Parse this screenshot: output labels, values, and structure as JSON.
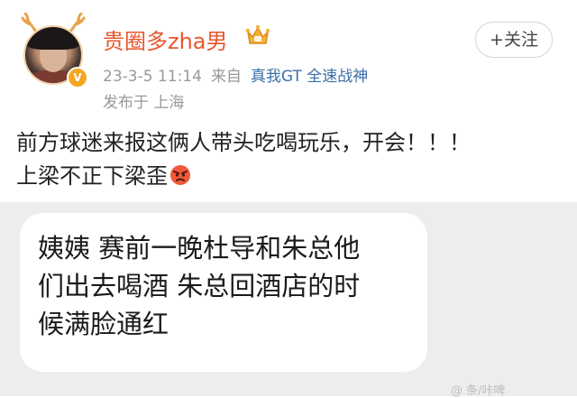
{
  "user": {
    "name": "贵圈多zha男",
    "verified_badge": "V",
    "follow_label": "+关注"
  },
  "meta": {
    "date": "23-3-5 11:14",
    "source_prefix": "来自",
    "device": "真我GT 全速战神",
    "location": "发布于 上海"
  },
  "post": {
    "line1": "前方球迷来报这俩人带头吃喝玩乐，开会！！！",
    "line2": "上梁不正下梁歪"
  },
  "image": {
    "bubble_lines": [
      "姨姨 赛前一晚杜导和朱总他",
      "们出去喝酒 朱总回酒店的时",
      "候满脸通红"
    ],
    "watermark": "@ 条/咔啤"
  },
  "icons": {
    "avatar_decoration": "antler-icon",
    "member_crown": "crown-icon",
    "emoji": "angry-face-icon"
  },
  "colors": {
    "username": "#e8562c",
    "device_link": "#3b6fa8",
    "meta_gray": "#999999",
    "image_bg": "#ededed"
  }
}
